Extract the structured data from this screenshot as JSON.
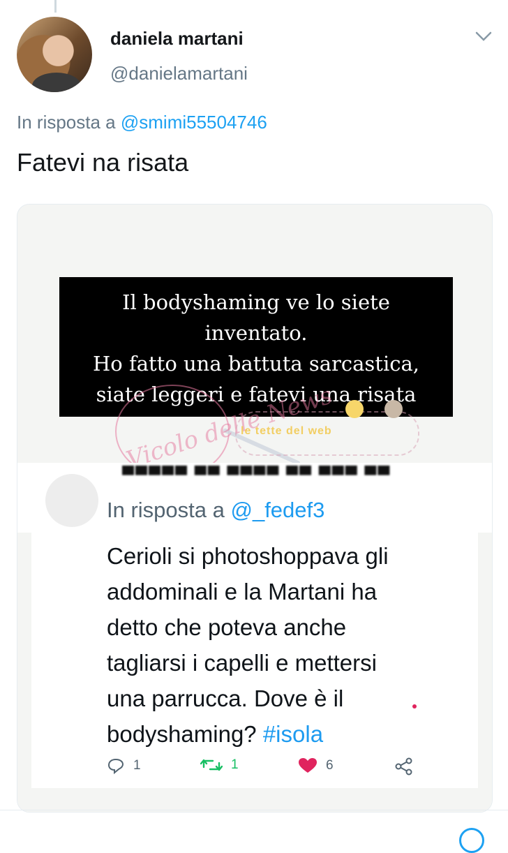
{
  "tweet": {
    "display_name": "daniela martani",
    "handle": "@danielamartani",
    "reply_prefix": "In risposta a ",
    "reply_mention": "@smimi55504746",
    "text": "Fatevi na risata"
  },
  "media": {
    "caption_lines": [
      "Il bodyshaming ve lo siete",
      "inventato.",
      "Ho fatto una battuta sarcastica,",
      "siate leggeri e fatevi una risata"
    ],
    "watermark_left_text": "Vicolo delle News",
    "watermark_right_text": "le tette del web",
    "inner_tweet": {
      "reply_prefix": "In risposta a ",
      "reply_mention": "@_fedef3",
      "body_lines": [
        "Cerioli si photoshoppava gli",
        "addominali e la Martani ha",
        "detto che poteva anche",
        "tagliarsi i capelli e mettersi",
        "una parrucca. Dove è il"
      ],
      "body_last_text": "bodyshaming? ",
      "hashtag": "#isola",
      "actions": {
        "replies": "1",
        "retweets": "1",
        "likes": "6"
      }
    }
  },
  "colors": {
    "link": "#1da1f2",
    "secondary_text": "#657786",
    "retweet": "#17bf63",
    "like": "#e0245e"
  }
}
